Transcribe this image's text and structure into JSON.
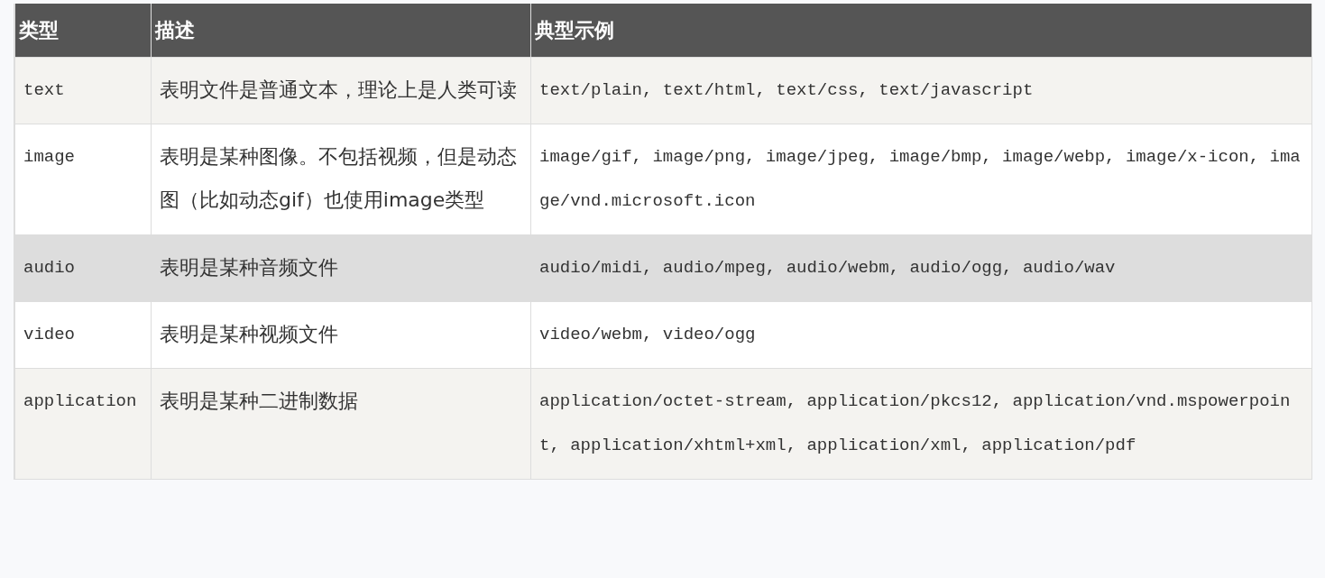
{
  "table": {
    "columns": [
      "类型",
      "描述",
      "典型示例"
    ],
    "rows": [
      {
        "type": "text",
        "description": "表明文件是普通文本，理论上是人类可读",
        "examples": "text/plain, text/html, text/css,  text/javascript",
        "highlighted": false
      },
      {
        "type": "image",
        "description": "表明是某种图像。不包括视频，但是动态图（比如动态gif）也使用image类型",
        "examples": "image/gif, image/png, image/jpeg, image/bmp, image/webp, image/x-icon, image/vnd.microsoft.icon",
        "highlighted": false
      },
      {
        "type": "audio",
        "description": "表明是某种音频文件",
        "examples": "audio/midi, audio/mpeg,  audio/webm,  audio/ogg,  audio/wav",
        "highlighted": true
      },
      {
        "type": "video",
        "description": "表明是某种视频文件",
        "examples": "video/webm, video/ogg",
        "highlighted": false
      },
      {
        "type": "application",
        "description": "表明是某种二进制数据",
        "examples": "application/octet-stream, application/pkcs12, application/vnd.mspowerpoint, application/xhtml+xml, application/xml,  application/pdf",
        "highlighted": false
      }
    ]
  }
}
